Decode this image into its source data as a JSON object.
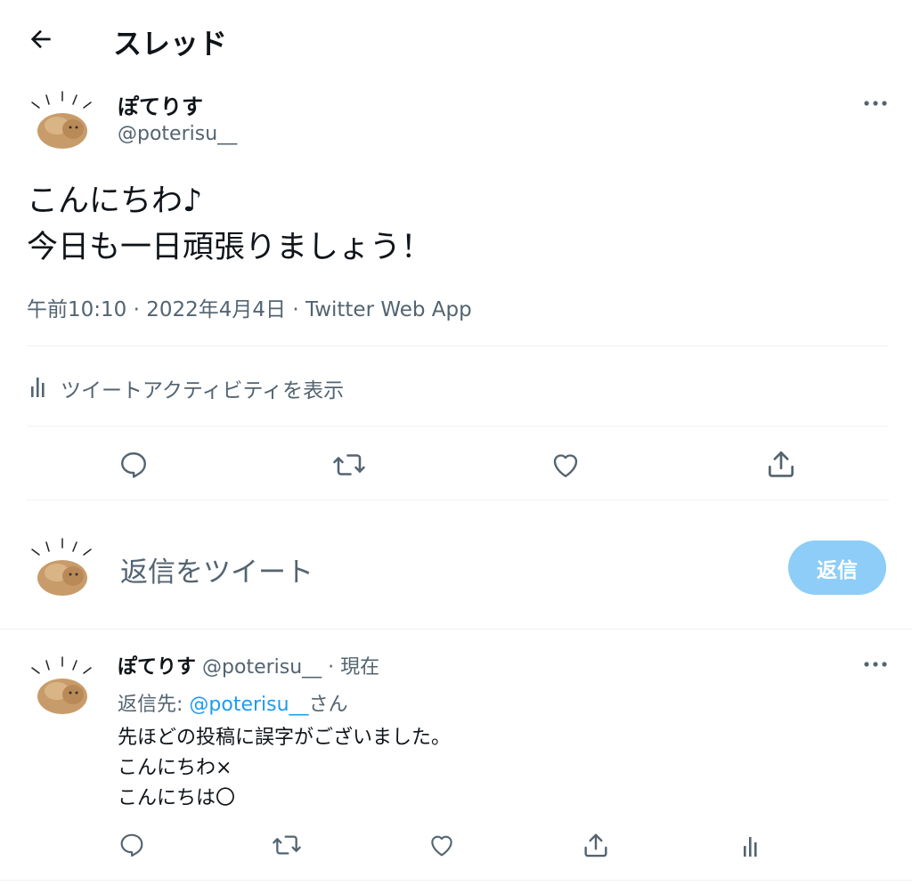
{
  "header": {
    "title": "スレッド"
  },
  "main_tweet": {
    "display_name": "ぽてりす",
    "handle": "@poterisu__",
    "lines": [
      "こんにちわ♪",
      "今日も一日頑張りましょう！"
    ],
    "meta": "午前10:10 · 2022年4月4日 · Twitter Web App",
    "activity_label": "ツイートアクティビティを表示"
  },
  "composer": {
    "placeholder": "返信をツイート",
    "reply_button": "返信"
  },
  "reply": {
    "display_name": "ぽてりす",
    "handle": "@poterisu__",
    "time": "· 現在",
    "reply_to_prefix": "返信先: ",
    "reply_to_handle": "@poterisu__",
    "reply_to_suffix": "さん",
    "lines": [
      "先ほどの投稿に誤字がございました。",
      "こんにちわ×",
      "こんにちは〇"
    ]
  },
  "colors": {
    "accent": "#1d9bf0",
    "accent_disabled": "#8ecdf7",
    "muted": "#536471"
  }
}
